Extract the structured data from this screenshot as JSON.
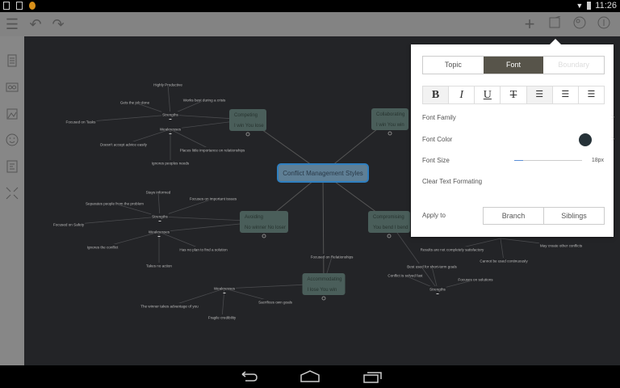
{
  "status_bar": {
    "time": "11:26",
    "icons": [
      "download-icon",
      "image-icon",
      "notification-icon",
      "wifi-icon",
      "battery-icon"
    ]
  },
  "toolbar": {
    "left": [
      "menu-icon",
      "undo-icon",
      "redo-icon"
    ],
    "right": [
      "add-icon",
      "edit-icon",
      "theme-icon",
      "info-icon"
    ]
  },
  "sidebar": {
    "items": [
      "outline-icon",
      "relationship-icon",
      "image-icon",
      "emoji-icon",
      "notes-icon",
      "collapse-icon"
    ]
  },
  "mindmap": {
    "central": "Conflict Management Styles",
    "nodes": [
      {
        "title": "Competing",
        "subtitle": "I win You lose"
      },
      {
        "title": "Collaborating",
        "subtitle": "I win You win"
      },
      {
        "title": "Avoiding",
        "subtitle": "No winner No loser"
      },
      {
        "title": "Compromising",
        "subtitle": "You bend I bend"
      },
      {
        "title": "Accommodating",
        "subtitle": "I lose You win"
      }
    ],
    "labels": [
      "Highly Productive",
      "Gets the job done",
      "Works best during a crisis",
      "Strengths",
      "Focused on Tasks",
      "Weaknesses",
      "Doesn't accept advice easily",
      "Places little importance on relationships",
      "Ignores peoples needs",
      "Stays informed",
      "Focuses on important issues",
      "Separates people from the problem",
      "Strengths",
      "Focused on Safety",
      "Weaknesses",
      "Ignores the conflict",
      "Has no plan to find a solution",
      "Takes no action",
      "Focused on Relationships",
      "Weaknesses",
      "Sacrifices own goals",
      "The winner takes advantage of you",
      "Fragile credibility",
      "Results are not completely satisfactory",
      "May create other conflicts",
      "Cannot be used continuously",
      "Best used for short-term goals",
      "Conflict is solved fast",
      "Focuses on solutions",
      "Strengths"
    ]
  },
  "panel": {
    "tabs": [
      {
        "label": "Topic"
      },
      {
        "label": "Font",
        "active": true
      },
      {
        "label": "Boundary",
        "disabled": true
      }
    ],
    "format_buttons": [
      {
        "glyph": "B",
        "name": "bold",
        "active": true
      },
      {
        "glyph": "I",
        "name": "italic"
      },
      {
        "glyph": "U",
        "name": "underline"
      },
      {
        "glyph": "T",
        "name": "strikethrough"
      },
      {
        "glyph": "☰",
        "name": "align-left",
        "active": true
      },
      {
        "glyph": "☰",
        "name": "align-center"
      },
      {
        "glyph": "☰",
        "name": "align-right"
      }
    ],
    "font_family": "Font Family",
    "font_color": "Font Color",
    "font_color_value": "#263238",
    "font_size": "Font Size",
    "font_size_value": "18px",
    "clear": "Clear Text Formating",
    "apply_to": "Apply to",
    "apply_options": [
      "Branch",
      "Siblings"
    ]
  },
  "colors": {
    "canvas": "#232427",
    "node": "#4a5e5a",
    "central": "#5f7f95",
    "central_border": "#2f7fc0",
    "toolbar": "#838383"
  }
}
